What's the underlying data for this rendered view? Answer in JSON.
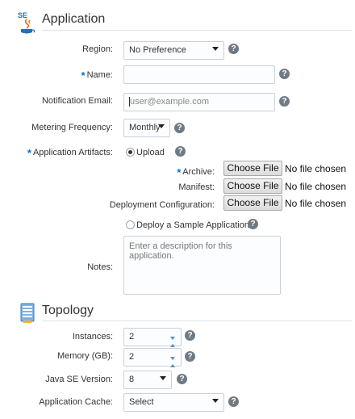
{
  "application_section": {
    "title": "Application",
    "icon_badge": "SE",
    "region": {
      "label": "Region:",
      "value": "No Preference"
    },
    "name": {
      "required_mark": "*",
      "label": "Name:",
      "value": ""
    },
    "notification_email": {
      "label": "Notification Email:",
      "placeholder": "user@example.com"
    },
    "metering_frequency": {
      "label": "Metering Frequency:",
      "value": "Monthly"
    },
    "artifacts": {
      "required_mark": "*",
      "label": "Application Artifacts:",
      "upload_label": "Upload",
      "upload_selected": true
    },
    "archive": {
      "required_mark": "*",
      "label": "Archive:",
      "button": "Choose File",
      "status": "No file chosen"
    },
    "manifest": {
      "label": "Manifest:",
      "button": "Choose File",
      "status": "No file chosen"
    },
    "deployment_config": {
      "label": "Deployment Configuration:",
      "button": "Choose File",
      "status": "No file chosen"
    },
    "sample": {
      "label": "Deploy a Sample Application",
      "selected": false
    },
    "notes": {
      "label": "Notes:",
      "placeholder": "Enter a description for this application."
    }
  },
  "topology_section": {
    "title": "Topology",
    "instances": {
      "label": "Instances:",
      "value": "2"
    },
    "memory": {
      "label": "Memory (GB):",
      "value": "2"
    },
    "java_version": {
      "label": "Java SE Version:",
      "value": "8"
    },
    "app_cache": {
      "label": "Application Cache:",
      "value": "Select"
    }
  },
  "help_glyph": "?",
  "colors": {
    "accent": "#0572ce",
    "help_icon": "#6f7a84",
    "field_border": "#c9d1d8"
  }
}
